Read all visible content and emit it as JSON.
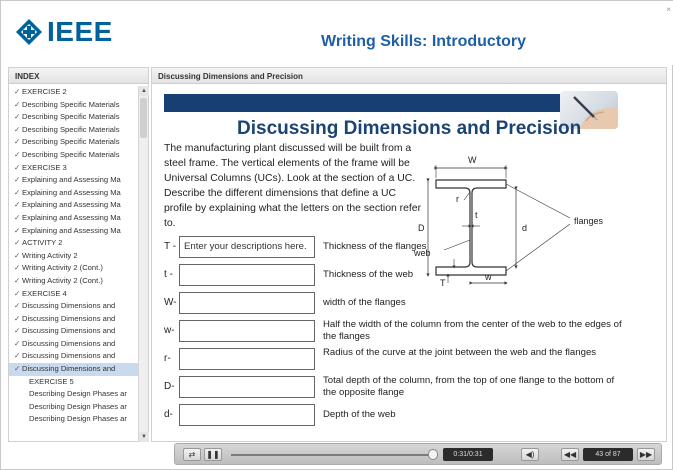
{
  "header": {
    "logo_text": "IEEE",
    "course_title": "Writing Skills: Introductory",
    "close_glyph": "×"
  },
  "index": {
    "title": "INDEX",
    "items": [
      {
        "label": "EXERCISE 2",
        "checked": true
      },
      {
        "label": "Describing Specific Materials",
        "checked": true
      },
      {
        "label": "Describing Specific Materials",
        "checked": true
      },
      {
        "label": "Describing Specific Materials",
        "checked": true
      },
      {
        "label": "Describing Specific Materials",
        "checked": true
      },
      {
        "label": "Describing Specific Materials",
        "checked": true
      },
      {
        "label": "EXERCISE 3",
        "checked": true
      },
      {
        "label": "Explaining and Assessing Ma",
        "checked": true
      },
      {
        "label": "Explaining and Assessing Ma",
        "checked": true
      },
      {
        "label": "Explaining and Assessing Ma",
        "checked": true
      },
      {
        "label": "Explaining and Assessing Ma",
        "checked": true
      },
      {
        "label": "Explaining and Assessing Ma",
        "checked": true
      },
      {
        "label": "ACTIVITY 2",
        "checked": true
      },
      {
        "label": "Writing Activity 2",
        "checked": true
      },
      {
        "label": "Writing Activity 2 (Cont.)",
        "checked": true
      },
      {
        "label": "Writing Activity 2 (Cont.)",
        "checked": true
      },
      {
        "label": "EXERCISE 4",
        "checked": true
      },
      {
        "label": "Discussing Dimensions and",
        "checked": true
      },
      {
        "label": "Discussing Dimensions and",
        "checked": true
      },
      {
        "label": "Discussing Dimensions and",
        "checked": true
      },
      {
        "label": "Discussing Dimensions and",
        "checked": true
      },
      {
        "label": "Discussing Dimensions and",
        "checked": true
      },
      {
        "label": "Discussing Dimensions and",
        "checked": true,
        "current": true
      },
      {
        "label": "EXERCISE 5",
        "checked": false
      },
      {
        "label": "Describing Design Phases ar",
        "checked": false
      },
      {
        "label": "Describing Design Phases ar",
        "checked": false
      },
      {
        "label": "Describing Design Phases ar",
        "checked": false
      }
    ]
  },
  "content": {
    "header": "Discussing Dimensions and Precision",
    "slide_title": "Discussing Dimensions and Precision",
    "intro": "The manufacturing plant discussed will be built from a steel frame. The vertical elements of the frame will be Universal Columns (UCs). Look at the section of a UC.  Describe the different dimensions that define a UC profile by explaining what the letters on the section refer to.",
    "diagram": {
      "W": "W",
      "w": "w",
      "D": "D",
      "d": "d",
      "r": "r",
      "t": "t",
      "T": "T",
      "flanges": "flanges",
      "web": "web"
    },
    "rows": [
      {
        "letter": "T -",
        "value": "Enter your descriptions here.",
        "desc": "Thickness of the flanges"
      },
      {
        "letter": "t -",
        "value": "",
        "desc": "Thickness of the web"
      },
      {
        "letter": "W-",
        "value": "",
        "desc": "width of the flanges"
      },
      {
        "letter": "w-",
        "value": "",
        "desc": "Half the width of the column from the center of the web to the edges of the flanges"
      },
      {
        "letter": "r-",
        "value": "",
        "desc": "Radius of the curve at the joint between the web and the flanges"
      },
      {
        "letter": "D-",
        "value": "",
        "desc": "Total depth of the column, from the top of one flange to the bottom of the opposite flange"
      },
      {
        "letter": "d-",
        "value": "",
        "desc": "Depth of the web"
      }
    ]
  },
  "player": {
    "time": "0:31/0:31",
    "slide_counter": "43 of 87",
    "progress": 1.0,
    "icons": [
      "captions-icon",
      "pause-icon",
      "volume-icon",
      "prev-icon",
      "next-icon"
    ]
  },
  "colors": {
    "brand": "#00629b",
    "title_blue": "#1f5fa8",
    "band": "#173f73",
    "current_item": "#c9d9ee"
  }
}
